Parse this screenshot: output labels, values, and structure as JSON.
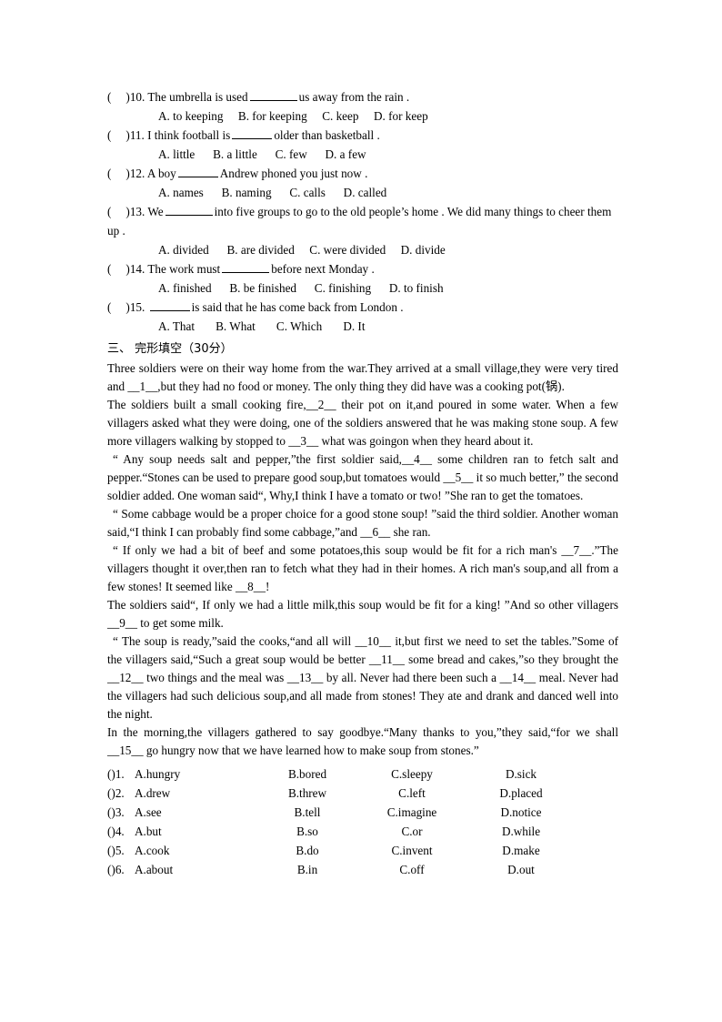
{
  "multiple_choice": {
    "questions": [
      {
        "paren": "(",
        "paren_close": ")",
        "number": "10.",
        "stem_before": "The umbrella is used",
        "blank": "lg",
        "stem_after": "us away from the rain .",
        "options": [
          "A. to keeping",
          "B. for keeping",
          "C. keep",
          "D. for keep"
        ]
      },
      {
        "paren": "(",
        "paren_close": ")",
        "number": "11.",
        "stem_before": "I think football is",
        "blank": "md",
        "stem_after": "older than basketball .",
        "options": [
          "A. little",
          "B. a little",
          "C. few",
          "D. a few"
        ]
      },
      {
        "paren": "(",
        "paren_close": ")",
        "number": "12.",
        "stem_before": "A boy",
        "blank": "md",
        "stem_after": "Andrew phoned you just now .",
        "options": [
          "A. names",
          "B. naming",
          "C. calls",
          "D. called"
        ]
      },
      {
        "paren": "(",
        "paren_close": ")",
        "number": "13.",
        "stem_before": "We",
        "blank": "lg",
        "stem_after": "into five groups to go to the old people’s home . We did many things to cheer them up .",
        "options": [
          "A. divided",
          "B. are divided",
          "C. were divided",
          "D. divide"
        ]
      },
      {
        "paren": "(",
        "paren_close": ")",
        "number": "14.",
        "stem_before": "The work must",
        "blank": "lg",
        "stem_after": "before next Monday .",
        "options": [
          "A. finished",
          "B. be finished",
          "C. finishing",
          "D. to finish"
        ]
      },
      {
        "paren": "(",
        "paren_close": ")",
        "number": "15.",
        "stem_before": "",
        "blank": "md",
        "stem_after": "is said that he has come back from London .",
        "options": [
          "A. That",
          "B. What",
          "C. Which",
          "D. It"
        ]
      }
    ]
  },
  "cloze_section": {
    "heading": "三、 完形填空（30分）",
    "paragraphs": [
      "Three soldiers were on their way home from the war.They arrived at a small village,they were very tired and __1__,but they had no food or money. The only thing they did have was a cooking pot(锅).",
      "The soldiers built a small cooking fire,__2__ their pot on it,and poured in some water. When a few villagers asked what they were doing, one of the soldiers answered that he was making stone soup. A few more villagers walking by stopped to __3__ what was goingon when they heard about it.",
      "“ Any soup needs salt and pepper,”the first soldier said,__4__ some children ran to fetch salt and pepper.“Stones can be used to prepare good soup,but tomatoes would __5__ it so much better,” the second soldier added. One woman said“, Why,I think I have a tomato or two! ”She ran to get the tomatoes.",
      "“ Some cabbage would be a proper choice for a good stone soup! ”said the third soldier. Another woman said,“I think I can probably find some cabbage,”and __6__ she ran.",
      "“ If only we had a bit of beef and some potatoes,this soup would be fit for a rich man's __7__.”The villagers thought it over,then ran to fetch what they had in their homes. A rich man's soup,and all from a few stones! It seemed like __8__!",
      "The soldiers said“, If only we had a little milk,this soup would be fit for a king! ”And so other villagers __9__ to get some milk.",
      "“ The soup is ready,”said the cooks,“and all will __10__ it,but first we need to set the tables.”Some of the villagers said,“Such a great soup would be better __11__ some bread and cakes,”so they brought the __12__ two things and the meal was __13__ by all. Never had there been such a __14__ meal. Never had the villagers had such delicious soup,and all made from stones! They ate and drank and danced well into the night.",
      "In the morning,the villagers gathered to say goodbye.“Many thanks to you,”they said,“for we shall __15__ go hungry now that we have learned how to make soup from stones.”"
    ],
    "answers": [
      {
        "paren": "(",
        "paren_close": ")",
        "number": "1.",
        "a": "A.hungry",
        "b": "B.bored",
        "c": "C.sleepy",
        "d": "D.sick"
      },
      {
        "paren": "(",
        "paren_close": ")",
        "number": "2.",
        "a": "A.drew",
        "b": "B.threw",
        "c": "C.left",
        "d": "D.placed"
      },
      {
        "paren": "(",
        "paren_close": ")",
        "number": "3.",
        "a": "A.see",
        "b": "B.tell",
        "c": "C.imagine",
        "d": "D.notice"
      },
      {
        "paren": "(",
        "paren_close": ")",
        "number": "4.",
        "a": "A.but",
        "b": "B.so",
        "c": "C.or",
        "d": "D.while"
      },
      {
        "paren": "(",
        "paren_close": ")",
        "number": "5.",
        "a": "A.cook",
        "b": "B.do",
        "c": "C.invent",
        "d": "D.make"
      },
      {
        "paren": "(",
        "paren_close": ")",
        "number": "6.",
        "a": "A.about",
        "b": "B.in",
        "c": "C.off",
        "d": "D.out"
      }
    ]
  }
}
